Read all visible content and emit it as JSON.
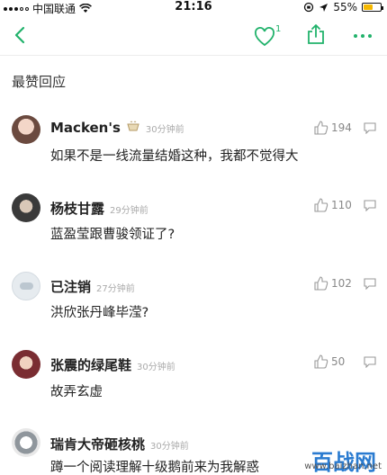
{
  "status_bar": {
    "carrier": "中国联通",
    "time": "21:16",
    "battery": "55%",
    "battery_level": 0.55
  },
  "nav": {
    "like_count": "1"
  },
  "section": {
    "title": "最赞回应"
  },
  "comments": [
    {
      "username": "Macken's",
      "time": "30分钟前",
      "likes": "194",
      "text": "如果不是一线流量结婚这种，我都不觉得大"
    },
    {
      "username": "杨枝甘露",
      "time": "29分钟前",
      "likes": "110",
      "text": "蓝盈莹跟曹骏领证了?"
    },
    {
      "username": "已注销",
      "time": "27分钟前",
      "likes": "102",
      "text": "洪欣张丹峰毕滢?"
    },
    {
      "username": "张震的绿尾鞋",
      "time": "30分钟前",
      "likes": "50",
      "text": "故弄玄虚"
    },
    {
      "username": "瑞肯大帝砸核桃",
      "time": "30分钟前",
      "likes": "",
      "text": "蹲一个阅读理解十级鹅前来为我解惑"
    }
  ],
  "watermark": {
    "brand": "百战网",
    "url": "www.baizhan.net"
  },
  "colors": {
    "accent": "#21b26b",
    "text": "#222222",
    "muted": "#aaaaaa"
  }
}
